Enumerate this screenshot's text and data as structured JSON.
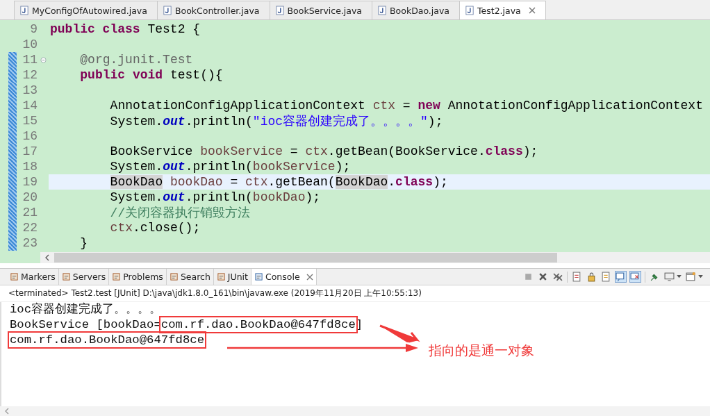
{
  "editor_tabs": [
    {
      "label": "MyConfigOfAutowired.java",
      "selected": false
    },
    {
      "label": "BookController.java",
      "selected": false
    },
    {
      "label": "BookService.java",
      "selected": false
    },
    {
      "label": "BookDao.java",
      "selected": false
    },
    {
      "label": "Test2.java",
      "selected": true
    }
  ],
  "code_lines": [
    {
      "number": "9",
      "current": false,
      "changed": false,
      "fold": false,
      "tokens": [
        {
          "t": "public class",
          "kind": "keyword"
        },
        {
          "t": " Test2 {",
          "kind": "plain"
        }
      ],
      "children": [
        {
          "number": "10",
          "current": false,
          "changed": false,
          "fold": false
        },
        {
          "number": "11",
          "current": false,
          "changed": true,
          "fold": true,
          "tokens": [
            {
              "t": "@org.junit.Test",
              "kind": "annotation"
            }
          ]
        },
        {
          "number": "12",
          "current": false,
          "changed": true,
          "fold": false,
          "tokens": [
            {
              "t": "public void",
              "kind": "keyword"
            },
            {
              "t": " test(){",
              "kind": "plain"
            }
          ],
          "children": [
            {
              "number": "13",
              "current": false,
              "changed": true,
              "fold": false
            },
            {
              "number": "14",
              "current": false,
              "changed": true,
              "fold": false,
              "tokens": [
                {
                  "t": "AnnotationConfigApplicationContext ",
                  "kind": "plain"
                },
                {
                  "t": "ctx",
                  "kind": "local"
                },
                {
                  "t": " = ",
                  "kind": "plain"
                },
                {
                  "t": "new",
                  "kind": "keyword"
                },
                {
                  "t": " AnnotationConfigApplicationContext",
                  "kind": "plain"
                }
              ]
            },
            {
              "number": "15",
              "current": false,
              "changed": true,
              "fold": false,
              "tokens": [
                {
                  "t": "System.",
                  "kind": "plain"
                },
                {
                  "t": "out",
                  "kind": "field"
                },
                {
                  "t": ".println(",
                  "kind": "plain"
                },
                {
                  "t": "\"ioc容器创建完成了。。。。\"",
                  "kind": "string"
                },
                {
                  "t": ");",
                  "kind": "plain"
                }
              ]
            },
            {
              "number": "16",
              "current": false,
              "changed": true,
              "fold": false
            },
            {
              "number": "17",
              "current": false,
              "changed": true,
              "fold": false,
              "tokens": [
                {
                  "t": "BookService ",
                  "kind": "plain"
                },
                {
                  "t": "bookService",
                  "kind": "local"
                },
                {
                  "t": " = ",
                  "kind": "plain"
                },
                {
                  "t": "ctx",
                  "kind": "local"
                },
                {
                  "t": ".getBean(BookService.",
                  "kind": "plain"
                },
                {
                  "t": "class",
                  "kind": "keyword"
                },
                {
                  "t": ");",
                  "kind": "plain"
                }
              ]
            },
            {
              "number": "18",
              "current": false,
              "changed": true,
              "fold": false,
              "tokens": [
                {
                  "t": "System.",
                  "kind": "plain"
                },
                {
                  "t": "out",
                  "kind": "field"
                },
                {
                  "t": ".println(",
                  "kind": "plain"
                },
                {
                  "t": "bookService",
                  "kind": "local"
                },
                {
                  "t": ");",
                  "kind": "plain"
                }
              ]
            },
            {
              "number": "19",
              "current": true,
              "changed": true,
              "fold": false,
              "tokens": [
                {
                  "t": "BookDao",
                  "kind": "occurrence"
                },
                {
                  "t": " bookDao",
                  "kind": "local"
                },
                {
                  "t": " = ",
                  "kind": "plain"
                },
                {
                  "t": "ctx",
                  "kind": "local"
                },
                {
                  "t": ".getBean(",
                  "kind": "plain"
                },
                {
                  "t": "BookDao",
                  "kind": "occurrence"
                },
                {
                  "t": ".",
                  "kind": "plain"
                },
                {
                  "t": "class",
                  "kind": "keyword"
                },
                {
                  "t": ");",
                  "kind": "plain"
                }
              ]
            },
            {
              "number": "20",
              "current": false,
              "changed": true,
              "fold": false,
              "tokens": [
                {
                  "t": "System.",
                  "kind": "plain"
                },
                {
                  "t": "out",
                  "kind": "field"
                },
                {
                  "t": ".println(",
                  "kind": "plain"
                },
                {
                  "t": "bookDao",
                  "kind": "local"
                },
                {
                  "t": ");",
                  "kind": "plain"
                }
              ]
            },
            {
              "number": "21",
              "current": false,
              "changed": true,
              "fold": false,
              "tokens": [
                {
                  "t": "//关闭容器执行销毁方法",
                  "kind": "comment"
                }
              ]
            },
            {
              "number": "22",
              "current": false,
              "changed": true,
              "fold": false,
              "tokens": [
                {
                  "t": "ctx",
                  "kind": "local"
                },
                {
                  "t": ".close();",
                  "kind": "plain"
                }
              ]
            }
          ]
        },
        {
          "number": "23",
          "current": false,
          "changed": true,
          "fold": false,
          "tokens": [
            {
              "t": "}",
              "kind": "plain"
            }
          ]
        }
      ]
    }
  ],
  "panel_tabs": [
    {
      "label": "Markers",
      "selected": false
    },
    {
      "label": "Servers",
      "selected": false
    },
    {
      "label": "Problems",
      "selected": false
    },
    {
      "label": "Search",
      "selected": false
    },
    {
      "label": "JUnit",
      "selected": false
    },
    {
      "label": "Console",
      "selected": true
    }
  ],
  "console": {
    "status": "<terminated> Test2.test [JUnit] D:\\java\\jdk1.8.0_161\\bin\\javaw.exe (2019年11月20日 上午10:55:13)",
    "lines": [
      [
        {
          "t": "ioc容器创建完成了。。。。",
          "boxed": false
        }
      ],
      [
        {
          "t": "BookService [bookDao=",
          "boxed": false
        },
        {
          "t": "com.rf.dao.BookDao@647fd8ce",
          "boxed": true
        },
        {
          "t": "]",
          "boxed": false
        }
      ],
      [
        {
          "t": "com.rf.dao.BookDao@647fd8ce",
          "boxed": true
        }
      ]
    ],
    "note": "指向的是通一对象"
  }
}
